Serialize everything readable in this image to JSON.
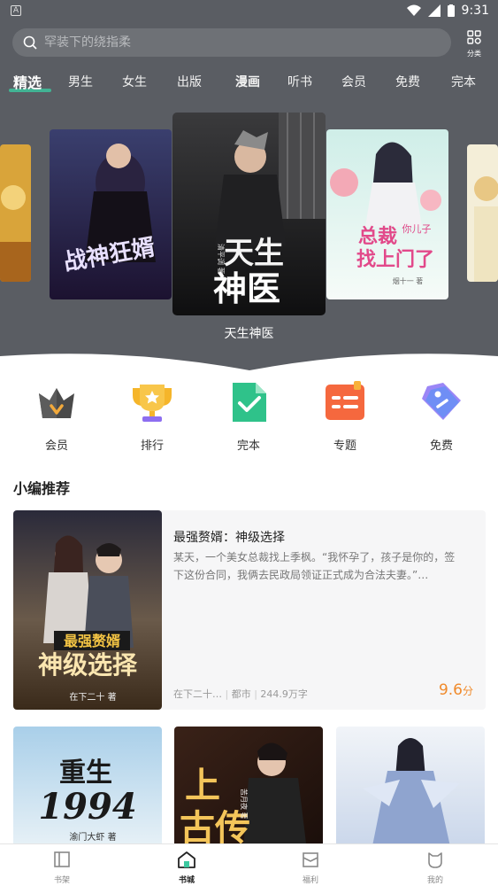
{
  "status_bar": {
    "time": "9:31",
    "left_badge": "A"
  },
  "search": {
    "placeholder": "罕装下的绕指柔"
  },
  "category": {
    "label": "分类"
  },
  "tabs": [
    {
      "label": "精选",
      "active": true
    },
    {
      "label": "男生"
    },
    {
      "label": "女生"
    },
    {
      "label": "出版"
    },
    {
      "label": "漫画"
    },
    {
      "label": "听书"
    },
    {
      "label": "会员"
    },
    {
      "label": "免费"
    },
    {
      "label": "完本"
    }
  ],
  "carousel": {
    "featured_title": "天生神医",
    "books": [
      {
        "cover_title": "战神狂婿"
      },
      {
        "cover_title": "天生神医",
        "cover_author": "清平调 著"
      },
      {
        "cover_title": "总裁找上门了",
        "cover_sub": "你儿子",
        "cover_author": "烟十一 著"
      }
    ]
  },
  "quick_links": [
    {
      "label": "会员",
      "icon": "crown-icon"
    },
    {
      "label": "排行",
      "icon": "trophy-icon"
    },
    {
      "label": "完本",
      "icon": "checked-doc-icon"
    },
    {
      "label": "专题",
      "icon": "topic-list-icon"
    },
    {
      "label": "免费",
      "icon": "free-tag-icon"
    }
  ],
  "section": {
    "title": "小编推荐"
  },
  "recommend": {
    "title": "最强赘婿：神级选择",
    "description": "某天，一个美女总裁找上季枫。“我怀孕了，孩子是你的，签下这份合同，我俩去民政局领证正式成为合法夫妻。”…",
    "author": "在下二十…",
    "genre": "都市",
    "words": "244.9万字",
    "score": "9.6",
    "score_unit": "分",
    "cover_title": "最强赘婿",
    "cover_sub": "神级选择",
    "cover_author": "在下二十 著"
  },
  "grid_covers": [
    {
      "title": "重生1994",
      "author": "渝门大虾 著"
    },
    {
      "title": "上古传",
      "author": "苦月夜 著"
    },
    {
      "title": ""
    }
  ],
  "bottom_nav": [
    {
      "label": "书架",
      "icon": "bookshelf-icon"
    },
    {
      "label": "书城",
      "icon": "bookstore-icon",
      "active": true
    },
    {
      "label": "福利",
      "icon": "gift-box-icon"
    },
    {
      "label": "我的",
      "icon": "profile-icon"
    }
  ],
  "colors": {
    "hero_bg": "#5a5d63",
    "accent": "#3cc9a0",
    "score": "#f08a2b"
  }
}
